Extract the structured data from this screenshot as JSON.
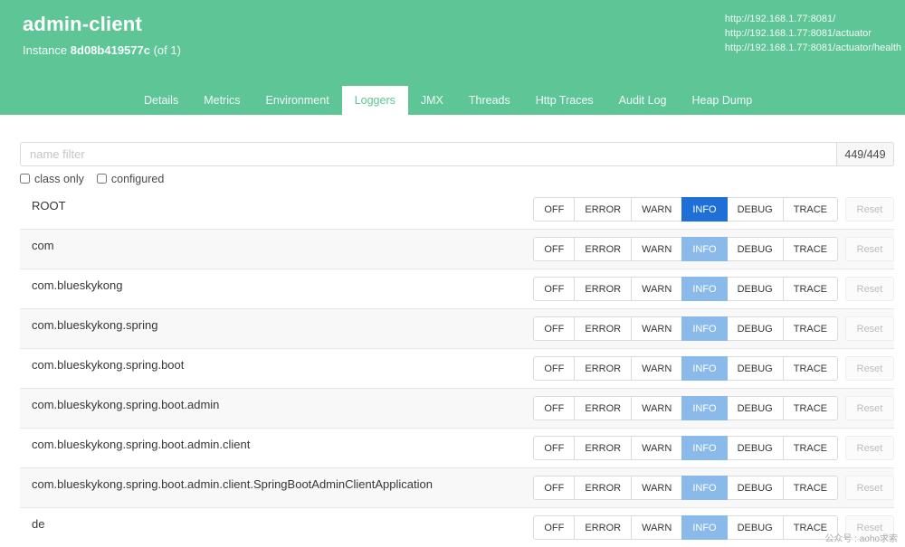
{
  "header": {
    "app_title": "admin-client",
    "instance_label": "Instance",
    "instance_id": "8d08b419577c",
    "instance_count": "(of 1)",
    "urls": [
      "http://192.168.1.77:8081/",
      "http://192.168.1.77:8081/actuator",
      "http://192.168.1.77:8081/actuator/health"
    ]
  },
  "tabs": [
    {
      "label": "Details",
      "active": false
    },
    {
      "label": "Metrics",
      "active": false
    },
    {
      "label": "Environment",
      "active": false
    },
    {
      "label": "Loggers",
      "active": true
    },
    {
      "label": "JMX",
      "active": false
    },
    {
      "label": "Threads",
      "active": false
    },
    {
      "label": "Http Traces",
      "active": false
    },
    {
      "label": "Audit Log",
      "active": false
    },
    {
      "label": "Heap Dump",
      "active": false
    }
  ],
  "filter": {
    "placeholder": "name filter",
    "counter": "449/449"
  },
  "checkboxes": [
    {
      "label": "class only",
      "checked": false
    },
    {
      "label": "configured",
      "checked": false
    }
  ],
  "levels": [
    "OFF",
    "ERROR",
    "WARN",
    "INFO",
    "DEBUG",
    "TRACE"
  ],
  "reset_label": "Reset",
  "loggers": [
    {
      "name": "ROOT",
      "level": "INFO",
      "configured": true
    },
    {
      "name": "com",
      "level": "INFO",
      "configured": false
    },
    {
      "name": "com.blueskykong",
      "level": "INFO",
      "configured": false
    },
    {
      "name": "com.blueskykong.spring",
      "level": "INFO",
      "configured": false
    },
    {
      "name": "com.blueskykong.spring.boot",
      "level": "INFO",
      "configured": false
    },
    {
      "name": "com.blueskykong.spring.boot.admin",
      "level": "INFO",
      "configured": false
    },
    {
      "name": "com.blueskykong.spring.boot.admin.client",
      "level": "INFO",
      "configured": false
    },
    {
      "name": "com.blueskykong.spring.boot.admin.client.SpringBootAdminClientApplication",
      "level": "INFO",
      "configured": false
    },
    {
      "name": "de",
      "level": "INFO",
      "configured": false
    }
  ],
  "watermark": "公众号 : aoho求索",
  "colors": {
    "header_green": "#5dc596",
    "configured_level": "#1e70d6",
    "inherited_level": "#8abae9"
  }
}
